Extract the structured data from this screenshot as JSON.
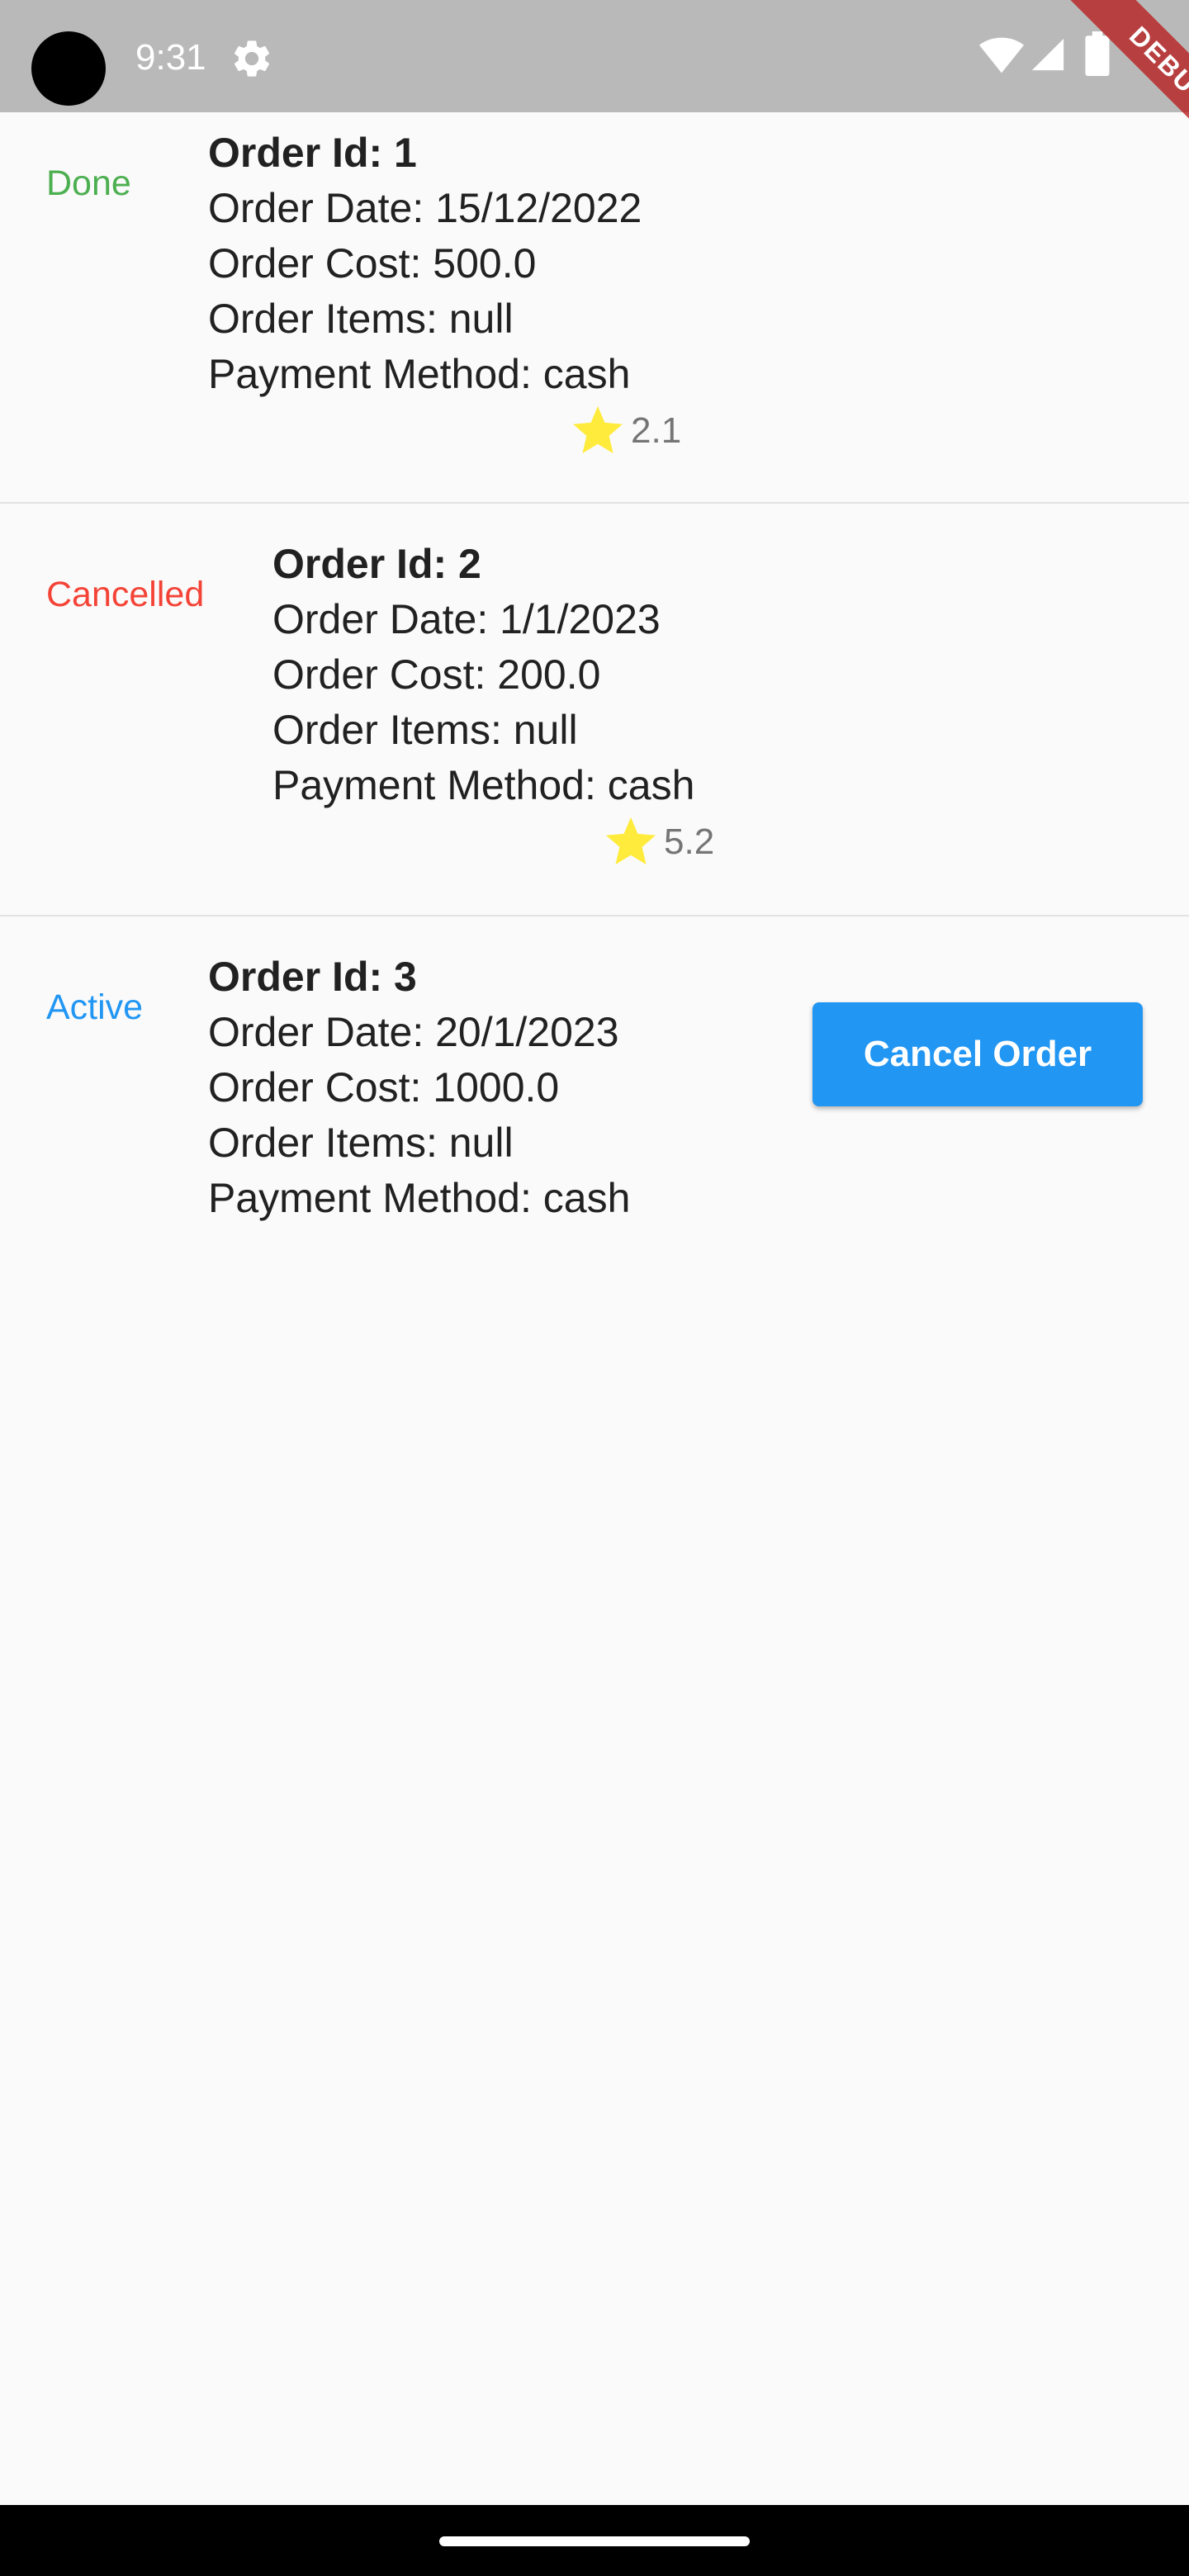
{
  "status_bar": {
    "time": "9:31",
    "icons": [
      "settings-icon",
      "wifi-icon",
      "signal-icon",
      "battery-icon"
    ]
  },
  "debug_banner": "DEBUG",
  "orders": [
    {
      "status": "Done",
      "status_color": "#4caf50",
      "title": "Order Id: 1",
      "date": "Order Date: 15/12/2022",
      "cost": "Order Cost: 500.0",
      "items": "Order Items: null",
      "payment": "Payment Method: cash",
      "rating": "2.1"
    },
    {
      "status": "Cancelled",
      "status_color": "#f44336",
      "title": "Order Id: 2",
      "date": "Order Date: 1/1/2023",
      "cost": "Order Cost: 200.0",
      "items": "Order Items: null",
      "payment": "Payment Method: cash",
      "rating": "5.2"
    },
    {
      "status": "Active",
      "status_color": "#2196f3",
      "title": "Order Id: 3",
      "date": "Order Date: 20/1/2023",
      "cost": "Order Cost: 1000.0",
      "items": "Order Items: null",
      "payment": "Payment Method: cash",
      "action_label": "Cancel Order"
    }
  ],
  "colors": {
    "star": "#ffeb3b",
    "button": "#2196f3",
    "debug_banner": "#b71c1c"
  }
}
